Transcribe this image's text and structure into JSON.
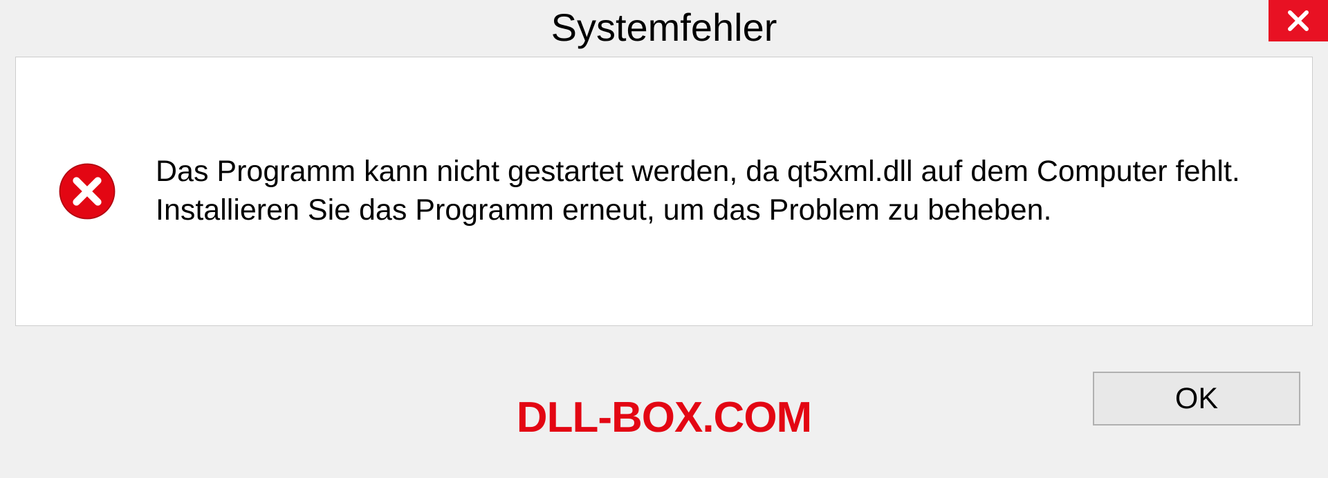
{
  "dialog": {
    "title": "Systemfehler",
    "message": "Das Programm kann nicht gestartet werden, da qt5xml.dll auf dem Computer fehlt. Installieren Sie das Programm erneut, um das Problem zu beheben.",
    "ok_label": "OK"
  },
  "watermark": "DLL-BOX.COM"
}
